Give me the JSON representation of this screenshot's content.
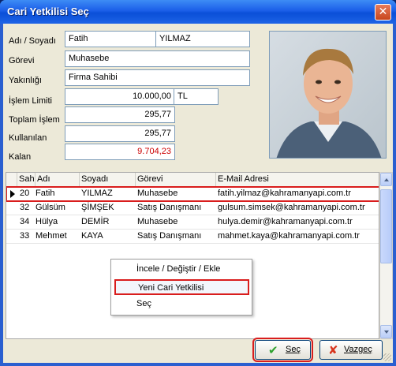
{
  "window": {
    "title": "Cari Yetkilisi Seç",
    "close_glyph": "✕"
  },
  "form": {
    "ad_label": "Adı / Soyadı",
    "ad_value": "Fatih",
    "soyad_value": "YILMAZ",
    "gorev_label": "Görevi",
    "gorev_value": "Muhasebe",
    "yakinlik_label": "Yakınlığı",
    "yakinlik_value": "Firma Sahibi",
    "limit_label": "İşlem Limiti",
    "limit_value": "10.000,00",
    "limit_currency": "TL",
    "toplam_label": "Toplam İşlem",
    "toplam_value": "295,77",
    "kullanilan_label": "Kullanılan",
    "kullanilan_value": "295,77",
    "kalan_label": "Kalan",
    "kalan_value": "9.704,23"
  },
  "grid": {
    "columns": [
      "Sah",
      "Adı",
      "Soyadı",
      "Görevi",
      "E-Mail Adresi"
    ],
    "rows": [
      {
        "no": "20",
        "ad": "Fatih",
        "soyad": "YILMAZ",
        "gorev": "Muhasebe",
        "email": "fatih.yilmaz@kahramanyapi.com.tr"
      },
      {
        "no": "32",
        "ad": "Gülsüm",
        "soyad": "ŞİMŞEK",
        "gorev": "Satış Danışmanı",
        "email": "gulsum.simsek@kahramanyapi.com.tr"
      },
      {
        "no": "34",
        "ad": "Hülya",
        "soyad": "DEMİR",
        "gorev": "Muhasebe",
        "email": "hulya.demir@kahramanyapi.com.tr"
      },
      {
        "no": "33",
        "ad": "Mehmet",
        "soyad": "KAYA",
        "gorev": "Satış Danışmanı",
        "email": "mahmet.kaya@kahramanyapi.com.tr"
      }
    ]
  },
  "context_menu": {
    "items": [
      "İncele / Değiştir / Ekle",
      "Yeni Cari Yetkilisi",
      "Seç"
    ]
  },
  "buttons": {
    "sec": {
      "label": "Seç",
      "icon": "check-icon",
      "color": "#2ea12e"
    },
    "vazgec": {
      "label": "Vazgeç",
      "icon": "cross-icon",
      "color": "#d8361e"
    }
  },
  "colors": {
    "highlight": "#d91d1d",
    "negative_red": "#cc0000"
  }
}
